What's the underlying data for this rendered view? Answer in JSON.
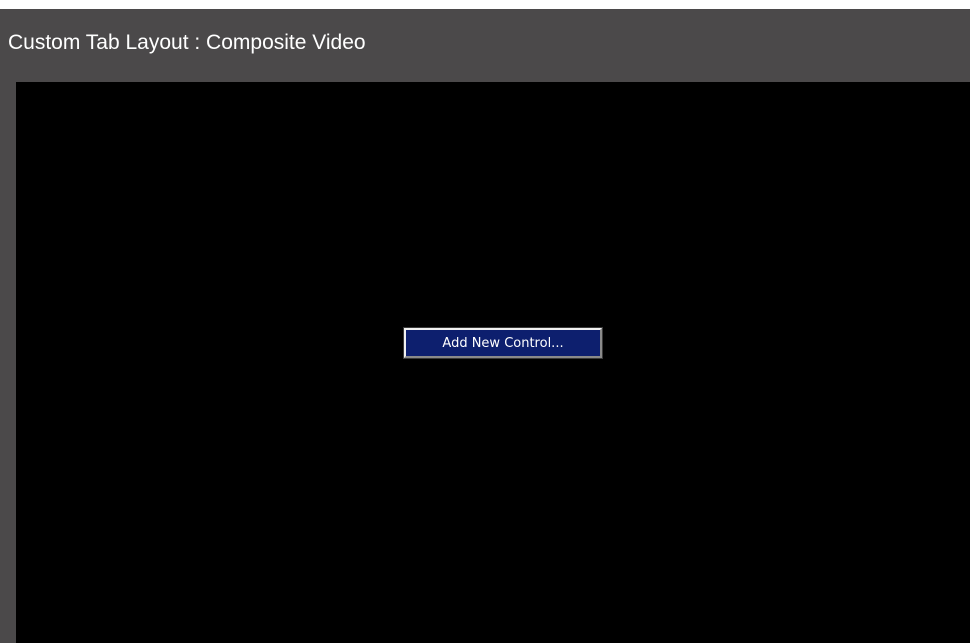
{
  "window": {
    "title": "Custom Tab Layout : Composite Video"
  },
  "canvas": {
    "add_control_label": "Add New Control..."
  },
  "colors": {
    "title_bar": "#4b494a",
    "canvas_background": "#000000",
    "button_background": "#0d1f6e",
    "text": "#ffffff"
  }
}
